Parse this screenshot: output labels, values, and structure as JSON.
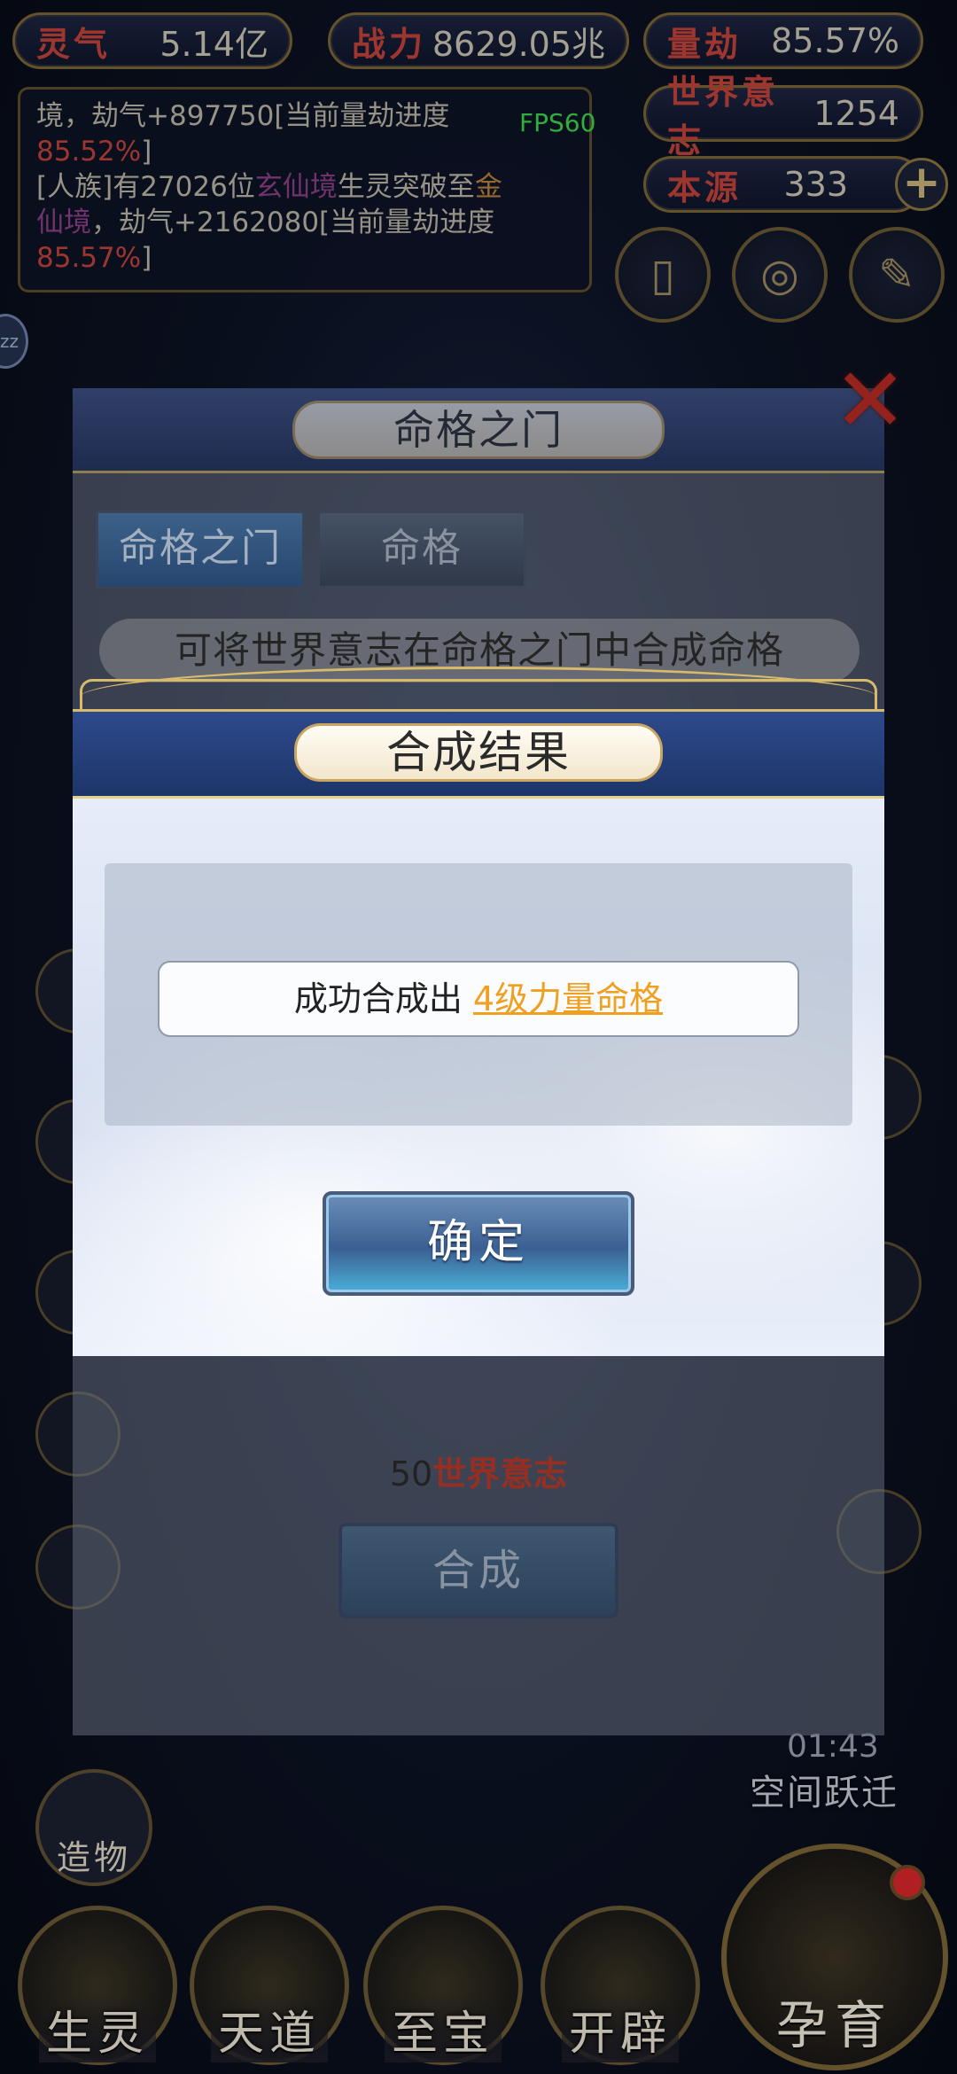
{
  "hud": {
    "lingqi": {
      "label": "灵气",
      "value": "5.14亿"
    },
    "zhanli": {
      "label": "战力",
      "value": "8629.05兆"
    },
    "liangjie": {
      "label": "量劫",
      "value": "85.57%"
    },
    "world_will": {
      "label": "世界意志",
      "value": "1254"
    },
    "benyuan": {
      "label": "本源",
      "value": "333"
    },
    "plus_symbol": "+",
    "fps": "FPS60",
    "sleep_badge": "zz"
  },
  "log": {
    "line1_a": "境，劫气+897750[当前量劫进度",
    "line1_b": "85.52%",
    "line1_c": "]",
    "line2_a": "[人族]有27026位",
    "line2_b": "玄仙境",
    "line2_c": "生灵突破至",
    "line2_d": "金",
    "line3_a": "仙境",
    "line3_b": "，劫气+2162080[当前量劫进度",
    "line4_a": "85.57%",
    "line4_b": "]"
  },
  "back_dialog": {
    "title": "命格之门",
    "tabs": [
      "命格之门",
      "命格"
    ],
    "description": "可将世界意志在命格之门中合成命格",
    "cost_amount": "50",
    "cost_unit": "世界意志",
    "synth_button": "合成"
  },
  "result_dialog": {
    "title": "合成结果",
    "message_prefix": "成功合成出",
    "item_name": "4级力量命格",
    "confirm_button": "确定"
  },
  "bottom_nav": {
    "items": [
      "生灵",
      "天道",
      "至宝",
      "开辟"
    ],
    "yunyu": "孕育",
    "zaowu": "造物",
    "space_jump": "空间跃迁",
    "timer": "01:43"
  },
  "colors": {
    "accent_red": "#c0423a",
    "gold_border": "#d8bb6a",
    "item_highlight": "#f0a020",
    "header_blue": "#2d4a8c"
  }
}
